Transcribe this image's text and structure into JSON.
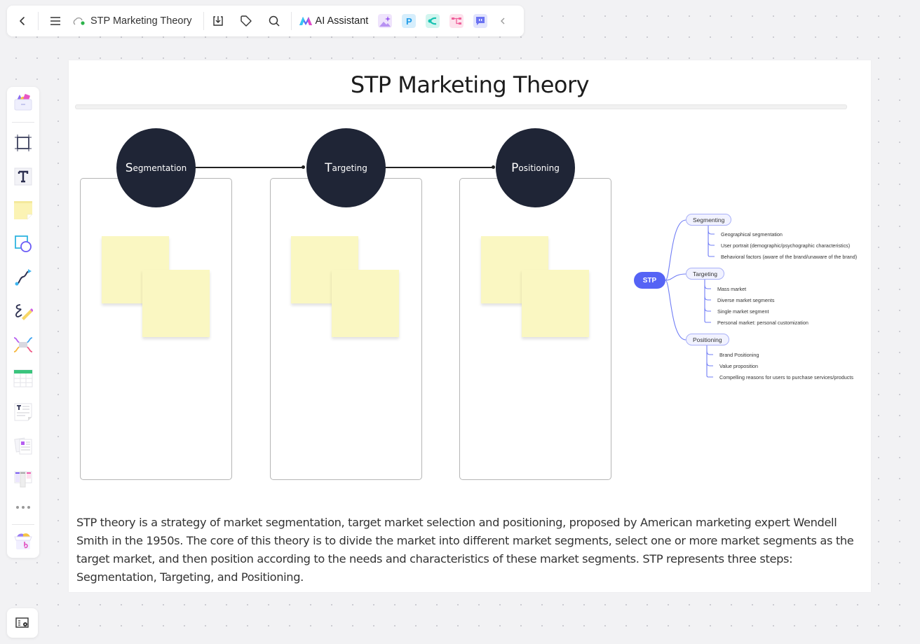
{
  "topbar": {
    "back_icon": "chevron-left-icon",
    "menu_icon": "hamburger-menu-icon",
    "cloud_icon": "cloud-synced-icon",
    "doc_title": "STP Marketing Theory",
    "download_icon": "download-icon",
    "tag_icon": "tag-icon",
    "search_icon": "search-icon",
    "ai_assistant_label": "AI Assistant",
    "apps": [
      {
        "name": "ai-image-app-icon",
        "color": "#b892f2"
      },
      {
        "name": "presentation-app-icon",
        "letter": "P",
        "color": "#1e9be8"
      },
      {
        "name": "mindmap-app-icon",
        "color": "#14c2b0"
      },
      {
        "name": "flowchart-app-icon",
        "color": "#f0609a"
      },
      {
        "name": "chat-app-icon",
        "color": "#6b73f2"
      }
    ],
    "collapse_icon": "chevron-left-icon"
  },
  "left_toolbar": {
    "items": [
      "templates-icon",
      "frame-icon",
      "text-icon",
      "sticky-note-icon",
      "shapes-icon",
      "connector-icon",
      "pen-icon",
      "mindmap-icon",
      "table-icon",
      "text-doc-icon",
      "cards-icon",
      "kanban-icon",
      "more-icon",
      "plugins-icon"
    ],
    "bottom_tool": "board-settings-icon"
  },
  "page": {
    "title": "STP Marketing Theory",
    "steps": [
      {
        "cap": "S",
        "rest": "egmentation"
      },
      {
        "cap": "T",
        "rest": "argeting"
      },
      {
        "cap": "P",
        "rest": "ositioning"
      }
    ],
    "description": "STP theory is a strategy of market segmentation, target market selection and positioning, proposed by American marketing expert Wendell Smith in the 1950s. The core of this theory is to divide the market into different market segments, select one or more market segments as the target market, and then position according to the needs and characteristics of these market segments. STP represents three steps: Segmentation, Targeting, and Positioning."
  },
  "mindmap": {
    "root": "STP",
    "accent_color": "#5563f5",
    "branches": [
      {
        "label": "Segmenting",
        "children": [
          "Geographical segmentation",
          "User portrait (demographic/psychographic characteristics)",
          "Behavioral factors (aware of the brand/unaware of the brand)"
        ]
      },
      {
        "label": "Targeting",
        "children": [
          "Mass market",
          "Diverse market segments",
          "Single market segment",
          "Personal market: personal customization"
        ]
      },
      {
        "label": "Positioning",
        "children": [
          "Brand Positioning",
          "Value proposition",
          "Compelling reasons for users to purchase services/products"
        ]
      }
    ]
  }
}
